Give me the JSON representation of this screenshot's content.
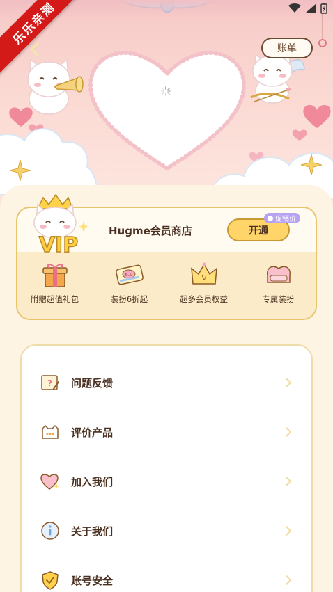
{
  "badge": {
    "text": "乐乐亲测"
  },
  "header": {
    "bill_label": "账单"
  },
  "vip": {
    "title": "Hugme会员商店",
    "open_label": "开通",
    "promo_label": "促销价",
    "benefits": [
      {
        "label": "附赠超值礼包",
        "icon": "gift-box-icon"
      },
      {
        "label": "装扮6折起",
        "icon": "discount-ticket-icon"
      },
      {
        "label": "超多会员权益",
        "icon": "crown-icon"
      },
      {
        "label": "专属装扮",
        "icon": "sofa-icon"
      }
    ]
  },
  "menu": {
    "items": [
      {
        "label": "问题反馈",
        "icon": "feedback-icon"
      },
      {
        "label": "评价产品",
        "icon": "rate-chat-icon"
      },
      {
        "label": "加入我们",
        "icon": "heart-join-icon"
      },
      {
        "label": "关于我们",
        "icon": "info-icon"
      },
      {
        "label": "账号安全",
        "icon": "shield-icon"
      }
    ]
  },
  "colors": {
    "accent": "#ffd56a",
    "card_border": "#e8c36a",
    "page_bg": "#fdf4e3",
    "ribbon": "#d41919"
  }
}
